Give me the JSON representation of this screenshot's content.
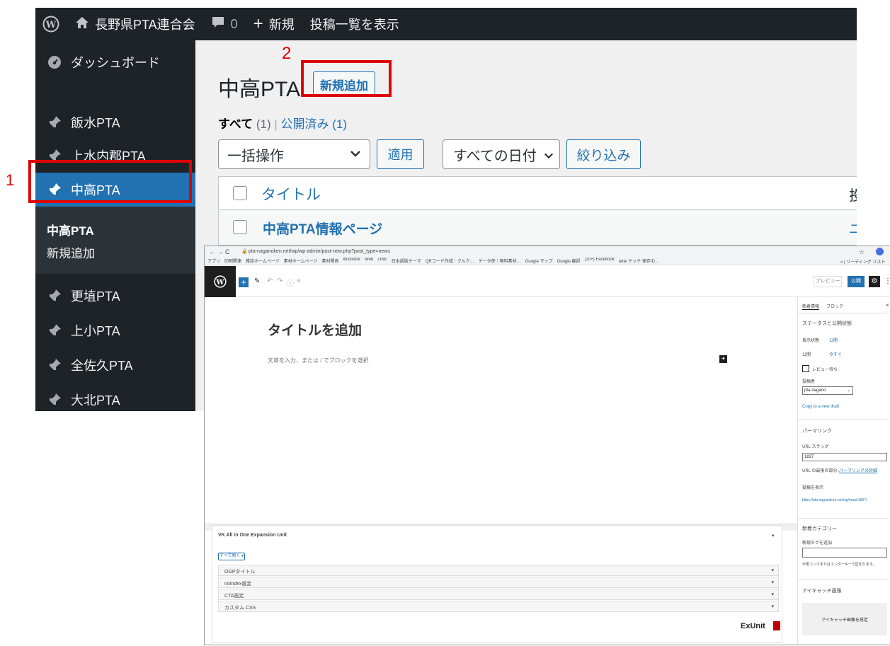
{
  "adminbar": {
    "site_name": "長野県PTA連合会",
    "comments_count": "0",
    "new_label": "新規",
    "view_posts": "投稿一覧を表示"
  },
  "sidebar": {
    "dashboard": "ダッシュボード",
    "items": [
      "飯水PTA",
      "上水内郡PTA",
      "中高PTA",
      "更埴PTA",
      "上小PTA",
      "全佐久PTA",
      "大北PTA"
    ],
    "submenu": [
      "中高PTA",
      "新規追加"
    ]
  },
  "main": {
    "page_title": "中高PTA",
    "add_new": "新規追加",
    "filter_all": "すべて",
    "filter_all_count": "(1)",
    "separator": "|",
    "filter_published": "公開済み (1)",
    "bulk_select": "一括操作",
    "apply": "適用",
    "date_select": "すべての日付",
    "filter_button": "絞り込み",
    "col_title": "タイトル",
    "row_title": "中高PTA情報ページ",
    "col_cut": "投",
    "row_cut": "ユ"
  },
  "annotations": {
    "step1": "1",
    "step2": "2"
  },
  "editor": {
    "url": "pta-naganoken.net/wp/wp-admin/post-new.php?post_type=news",
    "bookmarks": [
      "アプリ",
      "印刷関連",
      "雑誌ホームページ",
      "素材ホームページ",
      "素材関係",
      "Illustrator",
      "Web",
      "LINE",
      "日本語版テーマ",
      "QRコード作成｜クルク…",
      "データ使｜無料素材…",
      "Google マップ",
      "Google 翻訳",
      "(20+) Facebook",
      "tette テッテ 保存ID…"
    ],
    "bookmarks_right": "» | リーディング リスト",
    "preview": "プレビュー",
    "publish": "公開",
    "title_placeholder": "タイトルを追加",
    "body_placeholder": "文章を入力、または / でブロックを選択",
    "tab_post": "新着情報",
    "tab_block": "ブロック",
    "close": "×",
    "status_title": "ステータスと公開状態",
    "visibility_label": "表示状態",
    "visibility_value": "公開",
    "publish_label": "公開",
    "publish_value": "今すぐ",
    "pending_review": "レビュー待ち",
    "author_label": "投稿者",
    "author_value": "pta-nagano",
    "copy_draft": "Copy to a new draft",
    "permalink_title": "パーマリンク",
    "url_slug_label": "URL スラッグ",
    "url_slug_value": "1837",
    "slug_note": "URL の最後の部分。",
    "permalink_link": "パーマリンクの詳細",
    "view_post": "投稿を表示",
    "post_url": "https://pta-naganoken.net/wp/news/1837/",
    "category_title": "新着カテゴリー",
    "add_tag": "新規タグを追加",
    "tag_note": "半角コンマまたはエンターキーで区切ります。",
    "featured_title": "アイキャッチ画像",
    "set_featured": "アイキャッチ画像を設定",
    "vk_title": "VK All in One Expansion Unit",
    "open_all": "すべて開く ▾",
    "vk_rows": [
      "OGPタイトル",
      "noindex設定",
      "CTA設定",
      "カスタム CSS"
    ],
    "exunit": "ExUnit"
  },
  "colors": {
    "admin_dark": "#1d2327",
    "accent_blue": "#2271b1",
    "highlight_red": "#e00000"
  }
}
